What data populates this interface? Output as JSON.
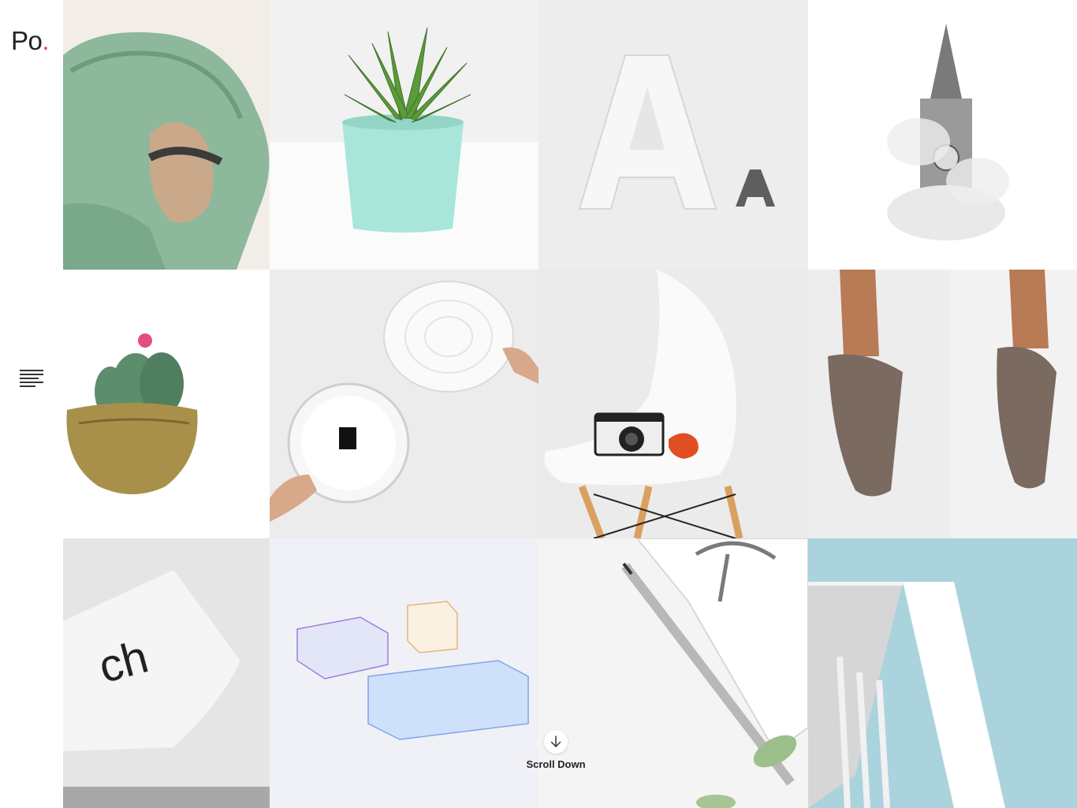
{
  "logo": {
    "text": "Po",
    "dot": "."
  },
  "accent_color": "#e33d6a",
  "menu": {
    "icon": "hamburger-icon"
  },
  "scroll": {
    "label": "Scroll Down",
    "icon": "arrow-down-icon"
  },
  "gallery": [
    "hooded-man-photo",
    "potted-aloe-photo",
    "letter-a-photo",
    "clock-tower-photo",
    "cactus-brass-pot-photo",
    "wall-clock-photo",
    "camera-chair-photo",
    "bronze-hands-photo",
    "ch-poster-photo",
    "glass-boxes-photo",
    "pencil-notebook-photo",
    "white-building-photo"
  ]
}
